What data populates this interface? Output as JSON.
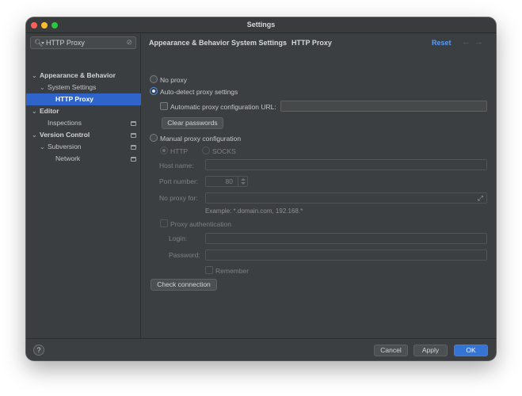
{
  "window": {
    "title": "Settings"
  },
  "sidebar": {
    "search": {
      "value": "HTTP Proxy"
    },
    "items": [
      {
        "label": "Appearance & Behavior"
      },
      {
        "label": "System Settings"
      },
      {
        "label": "HTTP Proxy"
      },
      {
        "label": "Editor"
      },
      {
        "label": "Inspections"
      },
      {
        "label": "Version Control"
      },
      {
        "label": "Subversion"
      },
      {
        "label": "Network"
      }
    ]
  },
  "breadcrumb": {
    "items": [
      "Appearance & Behavior",
      "System Settings",
      "HTTP Proxy"
    ],
    "separator": "›",
    "reset_label": "Reset"
  },
  "proxy": {
    "no_proxy_label": "No proxy",
    "auto_detect_label": "Auto-detect proxy settings",
    "auto_config_url_label": "Automatic proxy configuration URL:",
    "auto_config_url_value": "",
    "clear_passwords_label": "Clear passwords",
    "manual_label": "Manual proxy configuration",
    "http_label": "HTTP",
    "socks_label": "SOCKS",
    "host_name_label": "Host name:",
    "host_name_value": "",
    "port_number_label": "Port number:",
    "port_number_value": "80",
    "no_proxy_for_label": "No proxy for:",
    "no_proxy_for_value": "",
    "example_text": "Example: *.domain.com, 192.168.*",
    "proxy_auth_label": "Proxy authentication",
    "login_label": "Login:",
    "login_value": "",
    "password_label": "Password:",
    "password_value": "",
    "remember_label": "Remember",
    "check_connection_label": "Check connection",
    "selected_mode": "Auto-detect proxy settings",
    "selected_protocol": "HTTP"
  },
  "footer": {
    "help_label": "?",
    "cancel_label": "Cancel",
    "apply_label": "Apply",
    "ok_label": "OK"
  },
  "colors": {
    "window_bg": "#3c3f41",
    "selection": "#2f65ca",
    "accent_link": "#5b9cf0",
    "primary_button": "#3574d4"
  }
}
